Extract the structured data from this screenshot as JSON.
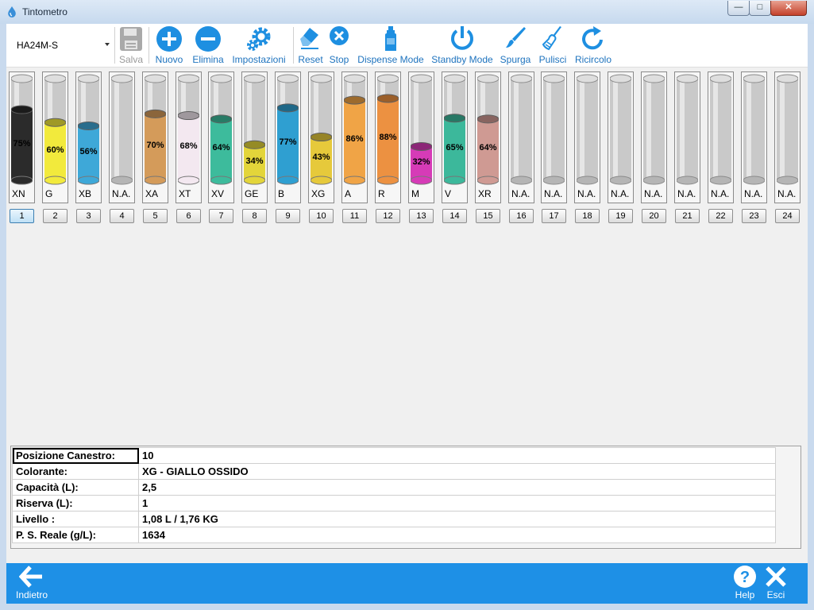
{
  "window": {
    "title": "Tintometro"
  },
  "toolbar": {
    "device": "HA24M-S",
    "buttons": {
      "salva": "Salva",
      "nuovo": "Nuovo",
      "elimina": "Elimina",
      "impostazioni": "Impostazioni",
      "reset": "Reset",
      "stop": "Stop",
      "dispense": "Dispense Mode",
      "standby": "Standby Mode",
      "spurga": "Spurga",
      "pulisci": "Pulisci",
      "ricircolo": "Ricircolo"
    },
    "accent": "#1e73be"
  },
  "canisters": [
    {
      "num": "1",
      "code": "XN",
      "level": 75,
      "label": "75%",
      "color": "#2b2b2b"
    },
    {
      "num": "2",
      "code": "G",
      "level": 60,
      "label": "60%",
      "color": "#f2ea3c"
    },
    {
      "num": "3",
      "code": "XB",
      "level": 56,
      "label": "56%",
      "color": "#3ea8d8"
    },
    {
      "num": "4",
      "code": "N.A.",
      "level": 0,
      "label": "",
      "color": ""
    },
    {
      "num": "5",
      "code": "XA",
      "level": 70,
      "label": "70%",
      "color": "#d49b5a"
    },
    {
      "num": "6",
      "code": "XT",
      "level": 68,
      "label": "68%",
      "color": "#f3e8f0"
    },
    {
      "num": "7",
      "code": "XV",
      "level": 64,
      "label": "64%",
      "color": "#3dbb9c"
    },
    {
      "num": "8",
      "code": "GE",
      "level": 34,
      "label": "34%",
      "color": "#e3d53a"
    },
    {
      "num": "9",
      "code": "B",
      "level": 77,
      "label": "77%",
      "color": "#2f9fd1"
    },
    {
      "num": "10",
      "code": "XG",
      "level": 43,
      "label": "43%",
      "color": "#e6c93b"
    },
    {
      "num": "11",
      "code": "A",
      "level": 86,
      "label": "86%",
      "color": "#f0a446"
    },
    {
      "num": "12",
      "code": "R",
      "level": 88,
      "label": "88%",
      "color": "#ec9141"
    },
    {
      "num": "13",
      "code": "M",
      "level": 32,
      "label": "32%",
      "color": "#d63bb7"
    },
    {
      "num": "14",
      "code": "V",
      "level": 65,
      "label": "65%",
      "color": "#3cb89b"
    },
    {
      "num": "15",
      "code": "XR",
      "level": 64,
      "label": "64%",
      "color": "#cf9a93"
    },
    {
      "num": "16",
      "code": "N.A.",
      "level": 0,
      "label": "",
      "color": ""
    },
    {
      "num": "17",
      "code": "N.A.",
      "level": 0,
      "label": "",
      "color": ""
    },
    {
      "num": "18",
      "code": "N.A.",
      "level": 0,
      "label": "",
      "color": ""
    },
    {
      "num": "19",
      "code": "N.A.",
      "level": 0,
      "label": "",
      "color": ""
    },
    {
      "num": "20",
      "code": "N.A.",
      "level": 0,
      "label": "",
      "color": ""
    },
    {
      "num": "21",
      "code": "N.A.",
      "level": 0,
      "label": "",
      "color": ""
    },
    {
      "num": "22",
      "code": "N.A.",
      "level": 0,
      "label": "",
      "color": ""
    },
    {
      "num": "23",
      "code": "N.A.",
      "level": 0,
      "label": "",
      "color": ""
    },
    {
      "num": "24",
      "code": "N.A.",
      "level": 0,
      "label": "",
      "color": ""
    }
  ],
  "selected_canister": "1",
  "info": {
    "rows": [
      {
        "key": "Posizione Canestro:",
        "value": "10"
      },
      {
        "key": "Colorante:",
        "value": "XG - GIALLO OSSIDO"
      },
      {
        "key": "Capacità (L):",
        "value": "2,5"
      },
      {
        "key": "Riserva (L):",
        "value": "1"
      },
      {
        "key": "Livello :",
        "value": "1,08 L / 1,76 KG"
      },
      {
        "key": "P. S. Reale (g/L):",
        "value": "1634"
      }
    ]
  },
  "bottombar": {
    "back": "Indietro",
    "help": "Help",
    "exit": "Esci",
    "color": "#1e90e6"
  }
}
